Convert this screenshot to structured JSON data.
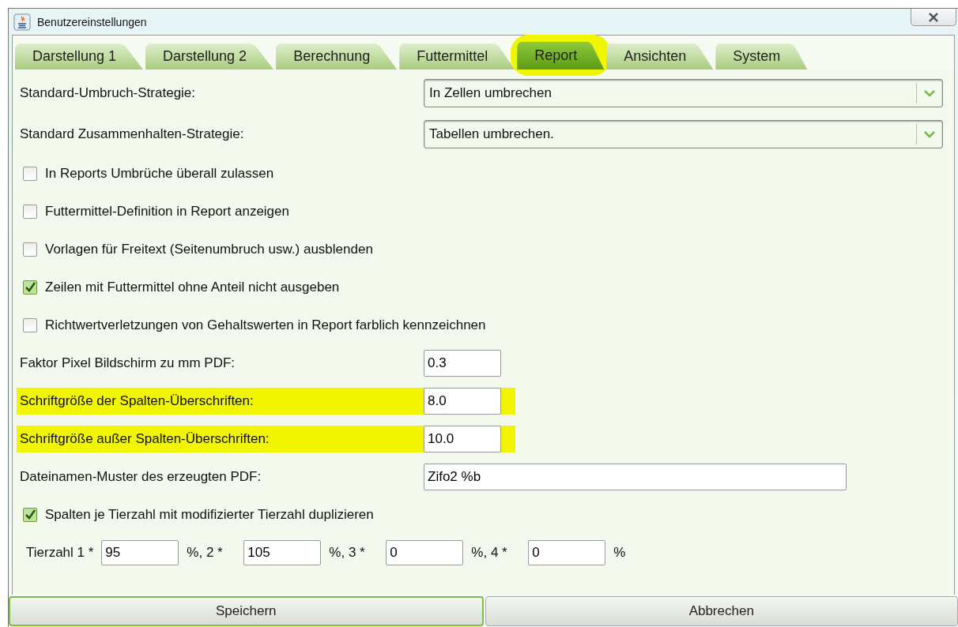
{
  "window": {
    "title": "Benutzereinstellungen"
  },
  "tabs": [
    {
      "label": "Darstellung 1",
      "selected": false,
      "highlighted": false
    },
    {
      "label": "Darstellung 2",
      "selected": false,
      "highlighted": false
    },
    {
      "label": "Berechnung",
      "selected": false,
      "highlighted": false
    },
    {
      "label": "Futtermittel",
      "selected": false,
      "highlighted": false
    },
    {
      "label": "Report",
      "selected": true,
      "highlighted": true
    },
    {
      "label": "Ansichten",
      "selected": false,
      "highlighted": false
    },
    {
      "label": "System",
      "selected": false,
      "highlighted": false
    }
  ],
  "settings": [
    {
      "kind": "dropdown",
      "label": "Standard-Umbruch-Strategie:",
      "value": "In Zellen umbrechen"
    },
    {
      "kind": "dropdown",
      "label": "Standard Zusammenhalten-Strategie:",
      "value": "Tabellen umbrechen."
    },
    {
      "kind": "checkbox",
      "label": "In Reports Umbrüche überall zulassen",
      "checked": false
    },
    {
      "kind": "checkbox",
      "label": "Futtermittel-Definition in Report anzeigen",
      "checked": false
    },
    {
      "kind": "checkbox",
      "label": "Vorlagen für Freitext (Seitenumbruch usw.) ausblenden",
      "checked": false
    },
    {
      "kind": "checkbox",
      "label": "Zeilen mit Futtermittel ohne Anteil nicht ausgeben",
      "checked": true
    },
    {
      "kind": "checkbox",
      "label": "Richtwertverletzungen von Gehaltswerten in Report farblich kennzeichnen",
      "checked": false
    },
    {
      "kind": "text",
      "label": "Faktor Pixel Bildschirm zu mm PDF:",
      "value": "0.3",
      "highlighted": false
    },
    {
      "kind": "text",
      "label": "Schriftgröße der Spalten-Überschriften:",
      "value": "8.0",
      "highlighted": true
    },
    {
      "kind": "text",
      "label": "Schriftgröße außer Spalten-Überschriften:",
      "value": "10.0",
      "highlighted": true
    },
    {
      "kind": "wide-text",
      "label": "Dateinamen-Muster des erzeugten PDF:",
      "value": "Zifo2 %b",
      "highlighted": false
    },
    {
      "kind": "checkbox",
      "label": "Spalten je Tierzahl mit modifizierter Tierzahl duplizieren",
      "checked": true
    },
    {
      "kind": "multiplier",
      "label": "Tierzahl 1 *",
      "fields": [
        {
          "value": "95",
          "suffix": "%, 2 *"
        },
        {
          "value": "105",
          "suffix": "%, 3 *"
        },
        {
          "value": "0",
          "suffix": "%, 4 *"
        },
        {
          "value": "0",
          "suffix": "%"
        }
      ]
    }
  ],
  "buttons": [
    {
      "label": "Speichern",
      "focused": true
    },
    {
      "label": "Abbrechen",
      "focused": false
    }
  ]
}
